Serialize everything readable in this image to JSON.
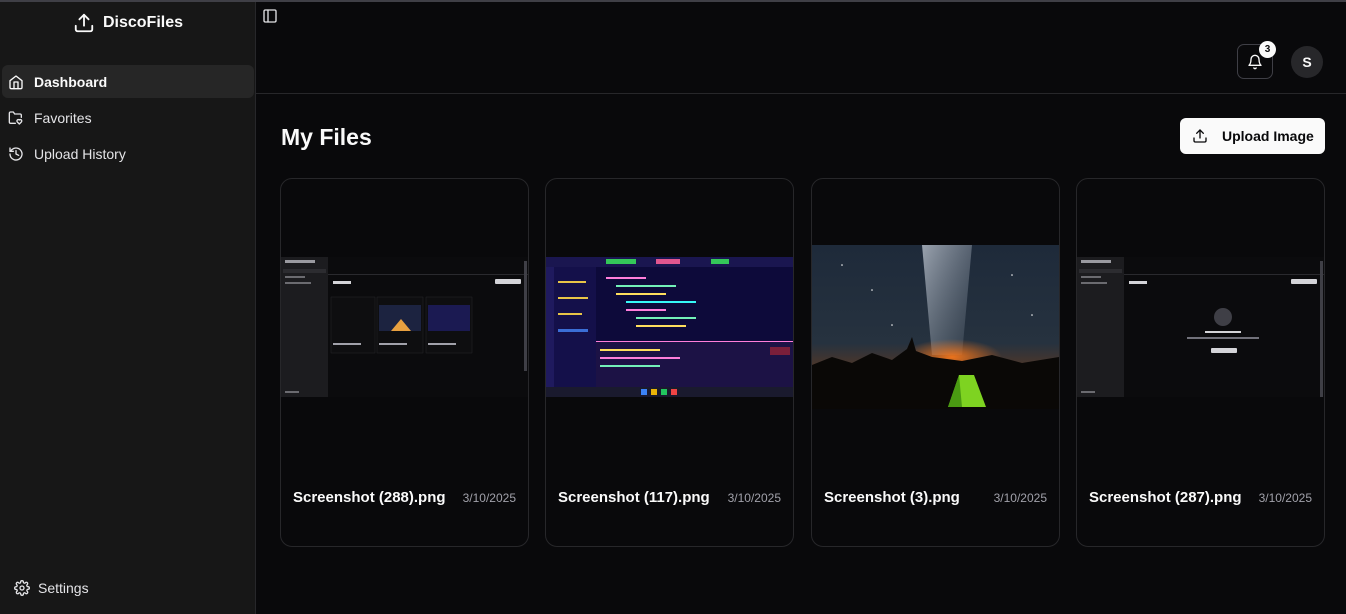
{
  "brand": {
    "name": "DiscoFiles",
    "icon": "upload-icon"
  },
  "sidebar": {
    "items": [
      {
        "label": "Dashboard",
        "icon": "home-icon",
        "active": true
      },
      {
        "label": "Favorites",
        "icon": "folder-heart-icon",
        "active": false
      },
      {
        "label": "Upload History",
        "icon": "history-icon",
        "active": false
      }
    ],
    "settings_label": "Settings"
  },
  "header": {
    "notification_count": "3",
    "avatar_initial": "S"
  },
  "main": {
    "title": "My Files",
    "upload_button_label": "Upload Image"
  },
  "files": [
    {
      "name": "Screenshot (288).png",
      "date": "3/10/2025"
    },
    {
      "name": "Screenshot (117).png",
      "date": "3/10/2025"
    },
    {
      "name": "Screenshot (3).png",
      "date": "3/10/2025"
    },
    {
      "name": "Screenshot (287).png",
      "date": "3/10/2025"
    }
  ],
  "colors": {
    "background": "#09090b",
    "sidebar": "#171717",
    "active_item": "#262626",
    "border": "#27272a",
    "button": "#fafafa"
  }
}
